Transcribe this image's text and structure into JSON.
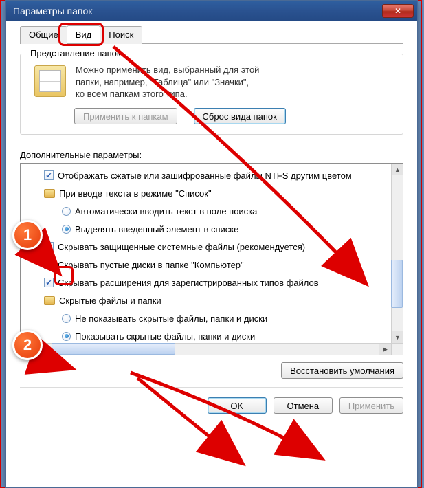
{
  "window": {
    "title": "Параметры папок",
    "close_glyph": "✕"
  },
  "tabs": [
    {
      "label": "Общие"
    },
    {
      "label": "Вид"
    },
    {
      "label": "Поиск"
    }
  ],
  "folder_view": {
    "group_title": "Представление папок",
    "desc_line1": "Можно применить вид, выбранный для этой",
    "desc_line2": "папки, например, \"Таблица\" или \"Значки\",",
    "desc_line3": "ко всем папкам этого типа.",
    "apply_btn": "Применить к папкам",
    "reset_btn": "Сброс вида папок"
  },
  "advanced": {
    "label": "Дополнительные параметры:",
    "items": [
      {
        "kind": "checkbox",
        "indent": 1,
        "checked": true,
        "text": "Отображать сжатые или зашифрованные файлы NTFS другим цветом"
      },
      {
        "kind": "folder",
        "indent": 1,
        "text": "При вводе текста в режиме \"Список\""
      },
      {
        "kind": "radio",
        "indent": 2,
        "checked": false,
        "text": "Автоматически вводить текст в поле поиска"
      },
      {
        "kind": "radio",
        "indent": 2,
        "checked": true,
        "text": "Выделять введенный элемент в списке"
      },
      {
        "kind": "checkbox",
        "indent": 1,
        "checked": false,
        "text": "Скрывать защищенные системные файлы (рекомендуется)"
      },
      {
        "kind": "checkbox",
        "indent": 1,
        "checked": true,
        "text": "Скрывать пустые диски в папке \"Компьютер\""
      },
      {
        "kind": "checkbox",
        "indent": 1,
        "checked": true,
        "text": "Скрывать расширения для зарегистрированных типов файлов"
      },
      {
        "kind": "folder",
        "indent": 1,
        "text": "Скрытые файлы и папки"
      },
      {
        "kind": "radio",
        "indent": 2,
        "checked": false,
        "text": "Не показывать скрытые файлы, папки и диски"
      },
      {
        "kind": "radio",
        "indent": 2,
        "checked": true,
        "text": "Показывать скрытые файлы, папки и диски"
      }
    ],
    "restore_btn": "Восстановить умолчания"
  },
  "dialog_buttons": {
    "ok": "OK",
    "cancel": "Отмена",
    "apply": "Применить"
  },
  "annotations": {
    "callout1": "1",
    "callout2": "2"
  }
}
